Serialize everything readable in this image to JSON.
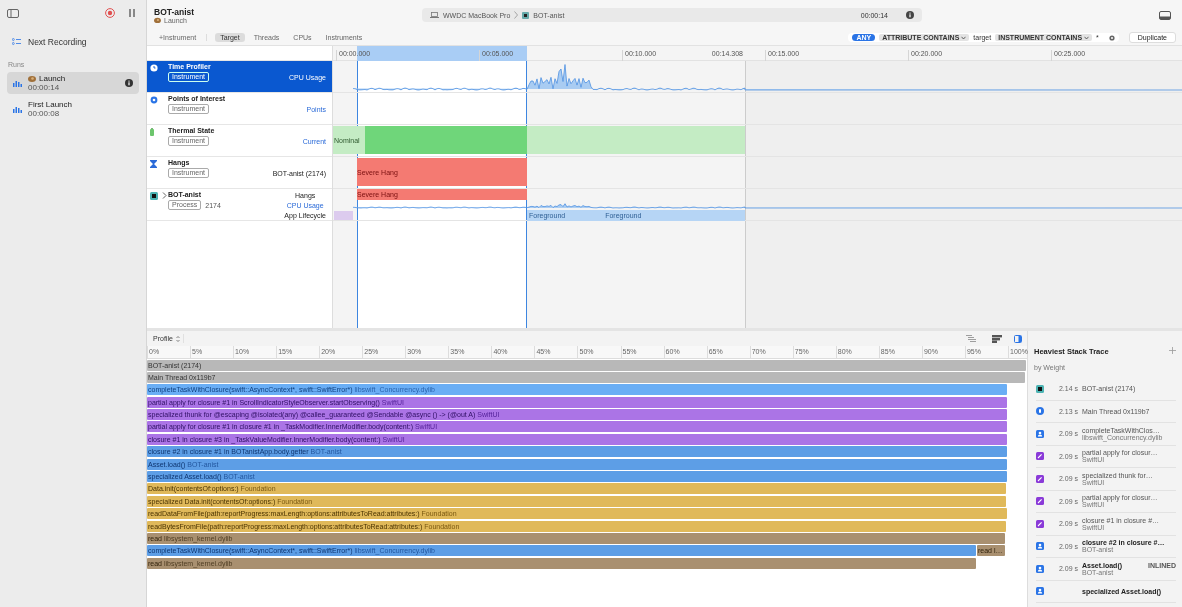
{
  "sidebar": {
    "next_recording": "Next Recording",
    "runs_label": "Runs",
    "runs": [
      {
        "name": "Launch",
        "duration": "00:00:14",
        "selected": true
      },
      {
        "name": "First Launch",
        "duration": "00:00:08",
        "selected": false
      }
    ]
  },
  "header": {
    "title": "BOT-anist",
    "subtitle": "Launch",
    "device": "WWDC MacBook Pro",
    "target": "BOT-anist",
    "elapsed": "00:00:14"
  },
  "toolbar": {
    "add_instrument": "+Instrument",
    "tabs": [
      {
        "label": "Target",
        "selected": true
      },
      {
        "label": "Threads",
        "selected": false
      },
      {
        "label": "CPUs",
        "selected": false
      },
      {
        "label": "Instruments",
        "selected": false
      }
    ],
    "filter": {
      "mode": "ANY",
      "attribute": "ATTRIBUTE CONTAINS",
      "attribute_value": "target",
      "instrument": "INSTRUMENT CONTAINS",
      "instrument_value": "*"
    },
    "duplicate": "Duplicate"
  },
  "timeline": {
    "ticks": [
      "00:00.000",
      "00:05.000",
      "00:10.000",
      "00:15.000",
      "00:20.000",
      "00:25.000"
    ],
    "end_label": "00:14.308"
  },
  "tracks": [
    {
      "name": "Time Profiler",
      "badge": "Instrument",
      "label": "CPU Usage",
      "kind": "profiler",
      "selected": true
    },
    {
      "name": "Points of Interest",
      "badge": "Instrument",
      "label": "Points",
      "kind": "poi",
      "selected": false
    },
    {
      "name": "Thermal State",
      "badge": "Instrument",
      "label": "Current",
      "kind": "thermal",
      "selected": false,
      "marks": [
        "Nominal"
      ]
    },
    {
      "name": "Hangs",
      "badge": "Instrument",
      "label": "BOT-anist (2174)",
      "kind": "hangs",
      "selected": false,
      "marks": [
        "Severe Hang"
      ]
    },
    {
      "name": "BOT-anist",
      "badge": "Process",
      "pid": "2174",
      "kind": "process",
      "expanded": false,
      "selected": false,
      "lanes": [
        {
          "label": "Hangs",
          "kind": "hangs",
          "marks": [
            "Severe Hang"
          ]
        },
        {
          "label": "CPU Usage",
          "kind": "cpu"
        },
        {
          "label": "App Lifecycle",
          "kind": "lifecycle",
          "marks": [
            "Foreground",
            "Foreground"
          ]
        }
      ]
    }
  ],
  "profile": {
    "mode": "Profile",
    "axis": [
      "0%",
      "5%",
      "10%",
      "15%",
      "20%",
      "25%",
      "30%",
      "35%",
      "40%",
      "45%",
      "50%",
      "55%",
      "60%",
      "65%",
      "70%",
      "75%",
      "80%",
      "85%",
      "90%",
      "95%",
      "100%"
    ],
    "flame_rows": [
      {
        "frames": [
          {
            "name": "BOT-anist (2174)",
            "kind": "process",
            "level": 1.0
          }
        ]
      },
      {
        "frames": [
          {
            "name": "Main Thread  0x119b7",
            "kind": "process",
            "level": 0.998
          }
        ]
      },
      {
        "frames": [
          {
            "name": "completeTaskWithClosure(swift::AsyncContext*, swift::SwiftError*)",
            "library": "libswift_Concurrency.dylib",
            "kind": "concurrency",
            "level": 0.977
          }
        ]
      },
      {
        "frames": [
          {
            "name": "partial apply for closure #1 in ScrollIndicatorStyleObserver.startObserving()",
            "library": "SwiftUI",
            "kind": "swiftui",
            "level": 0.977
          }
        ]
      },
      {
        "frames": [
          {
            "name": "specialized thunk for @escaping @isolated(any) @callee_guaranteed @Sendable @async () -> (@out A)",
            "library": "SwiftUI",
            "kind": "swiftui",
            "level": 0.977
          }
        ]
      },
      {
        "frames": [
          {
            "name": "partial apply for closure #1 in closure #1 in _TaskModifier.InnerModifier.body(content:)",
            "library": "SwiftUI",
            "kind": "swiftui",
            "level": 0.977
          }
        ]
      },
      {
        "frames": [
          {
            "name": "closure #1 in closure #3 in _TaskValueModifier.InnerModifier.body(content:)",
            "library": "SwiftUI",
            "kind": "swiftui",
            "level": 0.977
          }
        ]
      },
      {
        "frames": [
          {
            "name": "closure #2 in closure #1 in BOTanistApp.body.getter",
            "library": "BOT-anist",
            "kind": "app",
            "level": 0.977
          }
        ]
      },
      {
        "frames": [
          {
            "name": "Asset.load()",
            "library": "BOT-anist",
            "kind": "app",
            "level": 0.977
          }
        ]
      },
      {
        "frames": [
          {
            "name": "specialized Asset.load()",
            "library": "BOT-anist",
            "kind": "app",
            "level": 0.977
          }
        ]
      },
      {
        "frames": [
          {
            "name": "Data.init(contentsOf:options:)",
            "library": "Foundation",
            "kind": "foundation",
            "level": 0.976
          }
        ]
      },
      {
        "frames": [
          {
            "name": "specialized Data.init(contentsOf:options:)",
            "library": "Foundation",
            "kind": "foundation",
            "level": 0.976
          }
        ]
      },
      {
        "frames": [
          {
            "name": "readDataFromFile(path:reportProgress:maxLength:options:attributesToRead:attributes:)",
            "library": "Foundation",
            "kind": "foundation",
            "level": 0.977
          }
        ]
      },
      {
        "frames": [
          {
            "name": "readBytesFromFile(path:reportProgress:maxLength:options:attributesToRead:attributes:)",
            "library": "Foundation",
            "kind": "foundation",
            "level": 0.976
          }
        ]
      },
      {
        "frames": [
          {
            "name": "read",
            "library": "libsystem_kernel.dylib",
            "kind": "kernel",
            "level": 0.975
          }
        ]
      },
      {
        "frames": [
          {
            "name": "completeTaskWithClosure(swift::AsyncContext*, swift::SwiftError*)",
            "library": "libswift_Concurrency.dylib",
            "kind": "app",
            "level": 0.942
          },
          {
            "name": "read l…",
            "kind": "kernel",
            "level": 0.032
          }
        ]
      },
      {
        "frames": [
          {
            "name": "read",
            "library": "libsystem_kernel.dylib",
            "kind": "kernel",
            "level": 0.942
          }
        ]
      }
    ]
  },
  "stack_trace": {
    "title": "Heaviest Stack Trace",
    "subtitle": "by Weight",
    "frames": [
      {
        "kind": "process",
        "weight": "2.14 s",
        "name": "BOT-anist (2174)",
        "bold": false
      },
      {
        "kind": "thread",
        "weight": "2.13 s",
        "name": "Main Thread  0x119b7",
        "bold": false
      },
      {
        "kind": "user",
        "weight": "2.09 s",
        "name": "completeTaskWithClos…",
        "library": "libswift_Concurrency.dylib",
        "bold": false
      },
      {
        "kind": "swiftui",
        "weight": "2.09 s",
        "name": "partial apply for closur…",
        "library": "SwiftUI",
        "bold": false
      },
      {
        "kind": "swiftui",
        "weight": "2.09 s",
        "name": "specialized thunk for…",
        "library": "SwiftUI",
        "bold": false
      },
      {
        "kind": "swiftui",
        "weight": "2.09 s",
        "name": "partial apply for closur…",
        "library": "SwiftUI",
        "bold": false
      },
      {
        "kind": "swiftui",
        "weight": "2.09 s",
        "name": "closure #1 in closure #…",
        "library": "SwiftUI",
        "bold": false
      },
      {
        "kind": "user",
        "weight": "2.09 s",
        "name": "closure #2 in closure #…",
        "library": "BOT-anist",
        "bold": true
      },
      {
        "kind": "user",
        "weight": "2.09 s",
        "name": "Asset.load()",
        "library": "BOT-anist",
        "bold": true,
        "badge": "INLINED"
      },
      {
        "kind": "user",
        "name": "specialized Asset.load()",
        "bold": true
      }
    ]
  }
}
